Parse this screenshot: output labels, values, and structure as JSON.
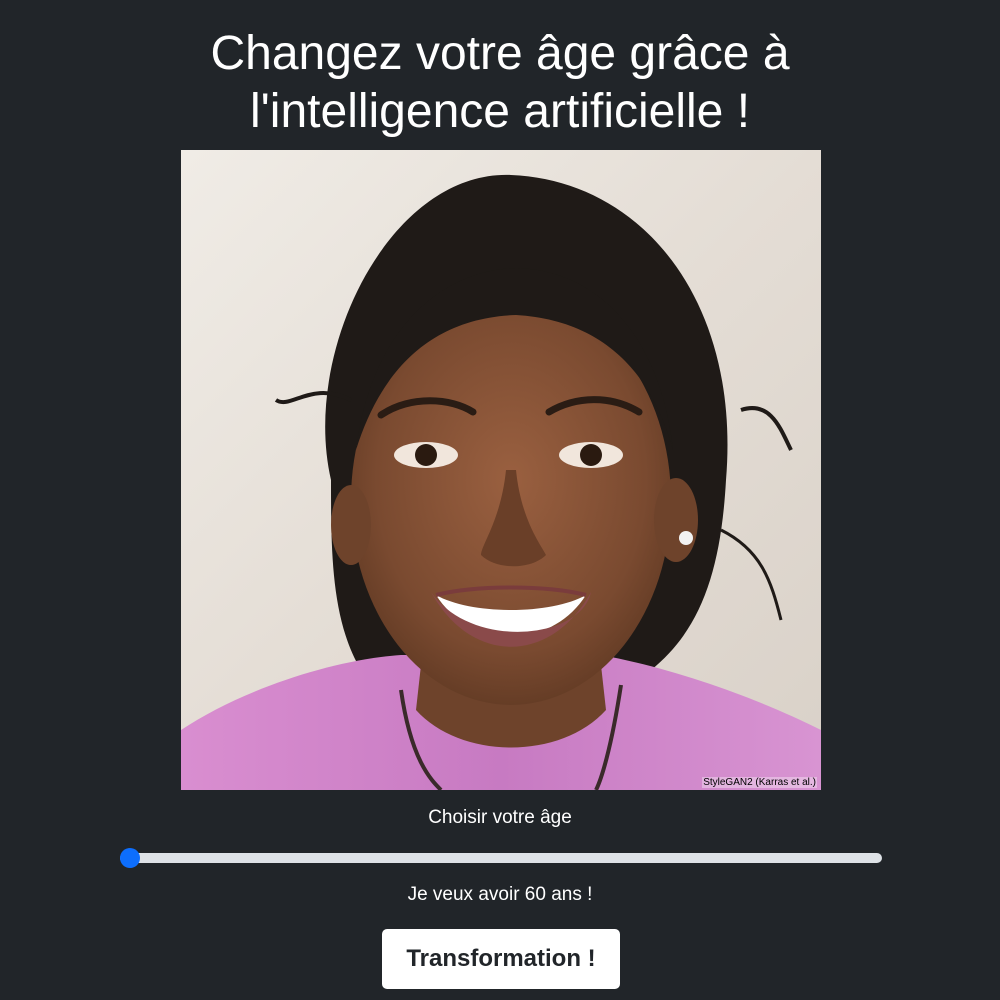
{
  "title": "Changez votre âge grâce à l'intelligence artificielle !",
  "portrait": {
    "credit": "StyleGAN2 (Karras et al.)"
  },
  "age_slider": {
    "label": "Choisir votre âge",
    "value_fraction": 0.0,
    "accent_color": "#0d6efd",
    "track_color": "#dee2e6"
  },
  "age_message": "Je veux avoir 60 ans !",
  "transform_button": {
    "label": "Transformation !"
  },
  "colors": {
    "background": "#212529",
    "text": "#ffffff",
    "button_bg": "#ffffff",
    "button_text": "#212529"
  }
}
